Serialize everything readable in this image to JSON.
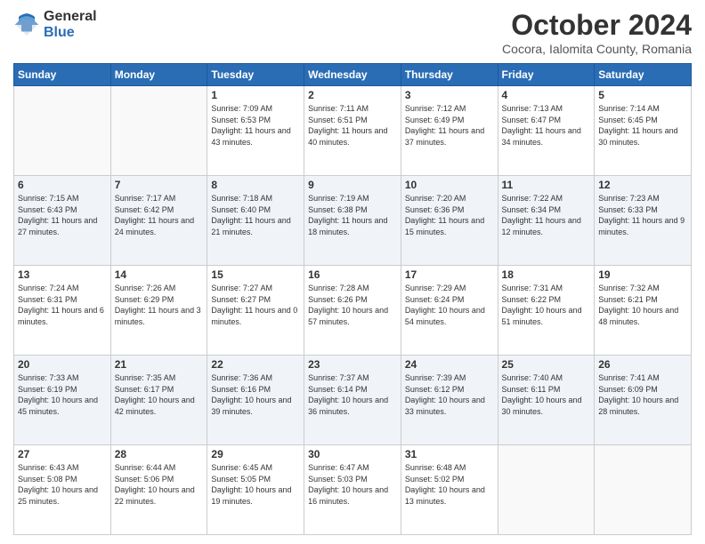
{
  "logo": {
    "general": "General",
    "blue": "Blue"
  },
  "header": {
    "month": "October 2024",
    "location": "Cocora, Ialomita County, Romania"
  },
  "weekdays": [
    "Sunday",
    "Monday",
    "Tuesday",
    "Wednesday",
    "Thursday",
    "Friday",
    "Saturday"
  ],
  "weeks": [
    [
      {
        "day": "",
        "sunrise": "",
        "sunset": "",
        "daylight": ""
      },
      {
        "day": "",
        "sunrise": "",
        "sunset": "",
        "daylight": ""
      },
      {
        "day": "1",
        "sunrise": "Sunrise: 7:09 AM",
        "sunset": "Sunset: 6:53 PM",
        "daylight": "Daylight: 11 hours and 43 minutes."
      },
      {
        "day": "2",
        "sunrise": "Sunrise: 7:11 AM",
        "sunset": "Sunset: 6:51 PM",
        "daylight": "Daylight: 11 hours and 40 minutes."
      },
      {
        "day": "3",
        "sunrise": "Sunrise: 7:12 AM",
        "sunset": "Sunset: 6:49 PM",
        "daylight": "Daylight: 11 hours and 37 minutes."
      },
      {
        "day": "4",
        "sunrise": "Sunrise: 7:13 AM",
        "sunset": "Sunset: 6:47 PM",
        "daylight": "Daylight: 11 hours and 34 minutes."
      },
      {
        "day": "5",
        "sunrise": "Sunrise: 7:14 AM",
        "sunset": "Sunset: 6:45 PM",
        "daylight": "Daylight: 11 hours and 30 minutes."
      }
    ],
    [
      {
        "day": "6",
        "sunrise": "Sunrise: 7:15 AM",
        "sunset": "Sunset: 6:43 PM",
        "daylight": "Daylight: 11 hours and 27 minutes."
      },
      {
        "day": "7",
        "sunrise": "Sunrise: 7:17 AM",
        "sunset": "Sunset: 6:42 PM",
        "daylight": "Daylight: 11 hours and 24 minutes."
      },
      {
        "day": "8",
        "sunrise": "Sunrise: 7:18 AM",
        "sunset": "Sunset: 6:40 PM",
        "daylight": "Daylight: 11 hours and 21 minutes."
      },
      {
        "day": "9",
        "sunrise": "Sunrise: 7:19 AM",
        "sunset": "Sunset: 6:38 PM",
        "daylight": "Daylight: 11 hours and 18 minutes."
      },
      {
        "day": "10",
        "sunrise": "Sunrise: 7:20 AM",
        "sunset": "Sunset: 6:36 PM",
        "daylight": "Daylight: 11 hours and 15 minutes."
      },
      {
        "day": "11",
        "sunrise": "Sunrise: 7:22 AM",
        "sunset": "Sunset: 6:34 PM",
        "daylight": "Daylight: 11 hours and 12 minutes."
      },
      {
        "day": "12",
        "sunrise": "Sunrise: 7:23 AM",
        "sunset": "Sunset: 6:33 PM",
        "daylight": "Daylight: 11 hours and 9 minutes."
      }
    ],
    [
      {
        "day": "13",
        "sunrise": "Sunrise: 7:24 AM",
        "sunset": "Sunset: 6:31 PM",
        "daylight": "Daylight: 11 hours and 6 minutes."
      },
      {
        "day": "14",
        "sunrise": "Sunrise: 7:26 AM",
        "sunset": "Sunset: 6:29 PM",
        "daylight": "Daylight: 11 hours and 3 minutes."
      },
      {
        "day": "15",
        "sunrise": "Sunrise: 7:27 AM",
        "sunset": "Sunset: 6:27 PM",
        "daylight": "Daylight: 11 hours and 0 minutes."
      },
      {
        "day": "16",
        "sunrise": "Sunrise: 7:28 AM",
        "sunset": "Sunset: 6:26 PM",
        "daylight": "Daylight: 10 hours and 57 minutes."
      },
      {
        "day": "17",
        "sunrise": "Sunrise: 7:29 AM",
        "sunset": "Sunset: 6:24 PM",
        "daylight": "Daylight: 10 hours and 54 minutes."
      },
      {
        "day": "18",
        "sunrise": "Sunrise: 7:31 AM",
        "sunset": "Sunset: 6:22 PM",
        "daylight": "Daylight: 10 hours and 51 minutes."
      },
      {
        "day": "19",
        "sunrise": "Sunrise: 7:32 AM",
        "sunset": "Sunset: 6:21 PM",
        "daylight": "Daylight: 10 hours and 48 minutes."
      }
    ],
    [
      {
        "day": "20",
        "sunrise": "Sunrise: 7:33 AM",
        "sunset": "Sunset: 6:19 PM",
        "daylight": "Daylight: 10 hours and 45 minutes."
      },
      {
        "day": "21",
        "sunrise": "Sunrise: 7:35 AM",
        "sunset": "Sunset: 6:17 PM",
        "daylight": "Daylight: 10 hours and 42 minutes."
      },
      {
        "day": "22",
        "sunrise": "Sunrise: 7:36 AM",
        "sunset": "Sunset: 6:16 PM",
        "daylight": "Daylight: 10 hours and 39 minutes."
      },
      {
        "day": "23",
        "sunrise": "Sunrise: 7:37 AM",
        "sunset": "Sunset: 6:14 PM",
        "daylight": "Daylight: 10 hours and 36 minutes."
      },
      {
        "day": "24",
        "sunrise": "Sunrise: 7:39 AM",
        "sunset": "Sunset: 6:12 PM",
        "daylight": "Daylight: 10 hours and 33 minutes."
      },
      {
        "day": "25",
        "sunrise": "Sunrise: 7:40 AM",
        "sunset": "Sunset: 6:11 PM",
        "daylight": "Daylight: 10 hours and 30 minutes."
      },
      {
        "day": "26",
        "sunrise": "Sunrise: 7:41 AM",
        "sunset": "Sunset: 6:09 PM",
        "daylight": "Daylight: 10 hours and 28 minutes."
      }
    ],
    [
      {
        "day": "27",
        "sunrise": "Sunrise: 6:43 AM",
        "sunset": "Sunset: 5:08 PM",
        "daylight": "Daylight: 10 hours and 25 minutes."
      },
      {
        "day": "28",
        "sunrise": "Sunrise: 6:44 AM",
        "sunset": "Sunset: 5:06 PM",
        "daylight": "Daylight: 10 hours and 22 minutes."
      },
      {
        "day": "29",
        "sunrise": "Sunrise: 6:45 AM",
        "sunset": "Sunset: 5:05 PM",
        "daylight": "Daylight: 10 hours and 19 minutes."
      },
      {
        "day": "30",
        "sunrise": "Sunrise: 6:47 AM",
        "sunset": "Sunset: 5:03 PM",
        "daylight": "Daylight: 10 hours and 16 minutes."
      },
      {
        "day": "31",
        "sunrise": "Sunrise: 6:48 AM",
        "sunset": "Sunset: 5:02 PM",
        "daylight": "Daylight: 10 hours and 13 minutes."
      },
      {
        "day": "",
        "sunrise": "",
        "sunset": "",
        "daylight": ""
      },
      {
        "day": "",
        "sunrise": "",
        "sunset": "",
        "daylight": ""
      }
    ]
  ]
}
